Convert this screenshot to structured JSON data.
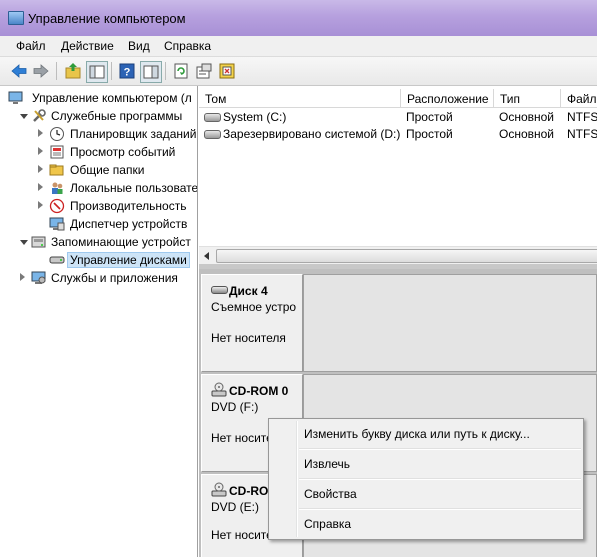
{
  "window": {
    "title": "Управление компьютером"
  },
  "menu": [
    "Файл",
    "Действие",
    "Вид",
    "Справка"
  ],
  "toolbar": {
    "icons": [
      "back-arrow-icon",
      "forward-arrow-icon",
      "up-folder-icon",
      "show-hide-tree-icon",
      "help-icon",
      "action-pane-icon",
      "refresh-icon",
      "properties-icon",
      "export-icon"
    ]
  },
  "tree": {
    "root": "Управление компьютером (л",
    "system_tools": "Служебные программы",
    "task_scheduler": "Планировщик заданий",
    "event_viewer": "Просмотр событий",
    "shared_folders": "Общие папки",
    "local_users": "Локальные пользовате",
    "performance": "Производительность",
    "device_manager": "Диспетчер устройств",
    "storage": "Запоминающие устройст",
    "disk_management": "Управление дисками",
    "services": "Службы и приложения"
  },
  "volumes": {
    "headers": {
      "volume": "Том",
      "layout": "Расположение",
      "type": "Тип",
      "fs": "Файл"
    },
    "rows": [
      {
        "volume": "System (C:)",
        "layout": "Простой",
        "type": "Основной",
        "fs": "NTFS"
      },
      {
        "volume": "Зарезервировано системой (D:)",
        "layout": "Простой",
        "type": "Основной",
        "fs": "NTFS"
      }
    ]
  },
  "disks": [
    {
      "name": "Диск 4",
      "sub1": "Съемное устро",
      "sub2": "Нет носителя"
    },
    {
      "name": "CD-ROM 0",
      "sub1": "DVD (F:)",
      "sub2": "Нет носите"
    },
    {
      "name": "CD-ROM",
      "sub1": "DVD (E:)",
      "sub2": "Нет носите"
    }
  ],
  "context_menu": {
    "change_letter": "Изменить букву диска или путь к диску...",
    "eject": "Извлечь",
    "properties": "Свойства",
    "help": "Справка"
  }
}
